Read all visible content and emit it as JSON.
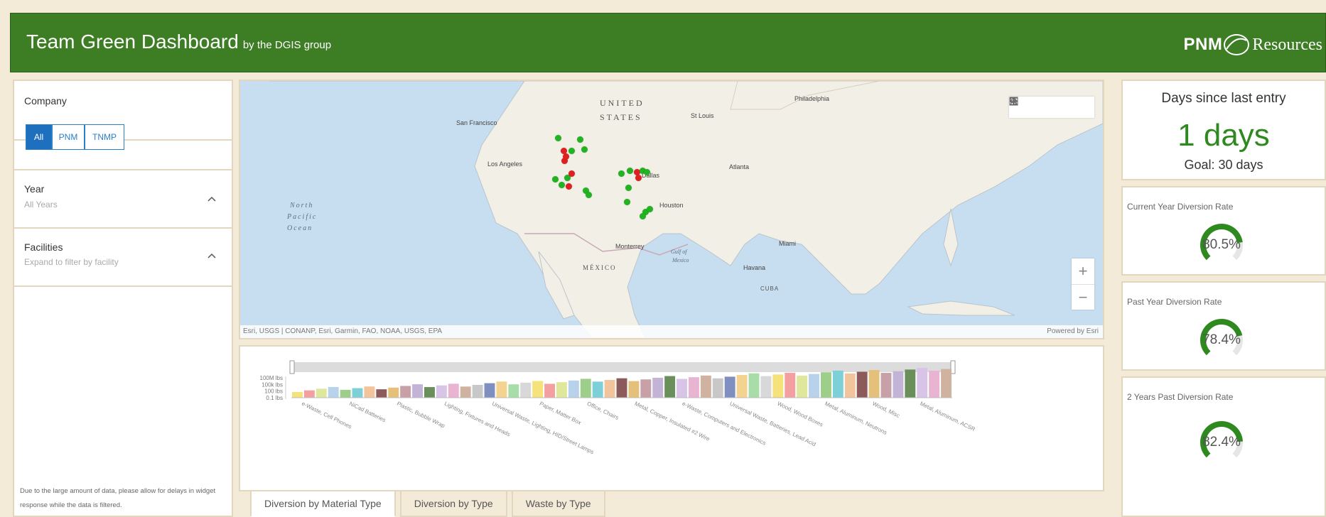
{
  "header": {
    "title": "Team Green Dashboard",
    "subtitle": "by the DGIS group",
    "logo_pnm": "PNM",
    "logo_resources": "Resources"
  },
  "filters": {
    "company_label": "Company",
    "company_options": [
      "All",
      "PNM",
      "TNMP"
    ],
    "company_selected": "All",
    "year_label": "Year",
    "year_value": "All Years",
    "facilities_label": "Facilities",
    "facilities_hint": "Expand to filter by facility",
    "note": "Due to the large amount of data, please allow for delays in widget response while the data is filtered."
  },
  "map": {
    "labels": {
      "united": "UNITED",
      "states": "STATES",
      "philadelphia": "Philadelphia",
      "san_francisco": "San Francisco",
      "st_louis": "St Louis",
      "los_angeles": "Los Angeles",
      "dallas": "Dallas",
      "atlanta": "Atlanta",
      "north": "North",
      "pacific": "Pacific",
      "ocean": "Ocean",
      "houston": "Houston",
      "monterrey": "Monterrey",
      "gulf_of": "Gulf of",
      "mexico_gulf": "Mexico",
      "miami": "Miami",
      "mexico": "MÉXICO",
      "havana": "Havana",
      "cuba": "CUBA"
    },
    "attribution": "Esri, USGS | CONANP, Esri, Garmin, FAO, NOAA, USGS, EPA",
    "powered_by": "Powered by Esri",
    "tools": [
      "search-icon",
      "home-icon",
      "legend-icon",
      "basemap-icon"
    ],
    "zoom_in": "+",
    "zoom_out": "−",
    "colors": {
      "green_marker": "#22b322",
      "red_marker": "#e02020",
      "water": "#c7def0",
      "land": "#f2efe6"
    }
  },
  "chart_data": {
    "type": "bar",
    "title": "",
    "y_scale": "log",
    "y_ticks": [
      "100M lbs",
      "100k lbs",
      "100 lbs",
      "0.1 lbs"
    ],
    "x_tick_labels": [
      "e-Waste, Cell Phones",
      "NiCad Batteries",
      "Plastic, Bubble Wrap",
      "Lighting, Fixtures and Heads",
      "Universal Waste, Lighting, HID/Street Lamps",
      "Paper, Matter Box",
      "Office, Chairs",
      "Metal, Copper, Insulated #2 Wire",
      "e-Waste, Computers and Electronics",
      "Universal Waste, Batteries, Lead Acid",
      "Wood, Wood Boxes",
      "Metal, Aluminum, Neutrons",
      "Wood, Misc",
      "Metal, Aluminum, ACSR"
    ],
    "bar_count": 55,
    "bar_colors": [
      "#f5e27a",
      "#b7d2ea",
      "#f2c49b",
      "#c8a0a8",
      "#d7c4e6",
      "#c8c8c8",
      "#a8dca8",
      "#f5a0a0",
      "#9ecf8a",
      "#8c5a5a",
      "#c3b3d7",
      "#e9b3d2",
      "#7f8fbf",
      "#d8d8d8",
      "#dfe89a",
      "#7dd0d8",
      "#e5c07b",
      "#6a8f5a",
      "#cfb3a0",
      "#f4d28f"
    ]
  },
  "tabs": [
    "Diversion by Material Type",
    "Diversion by Type",
    "Waste by Type"
  ],
  "tab_selected": "Diversion by Material Type",
  "indicators": {
    "days_title": "Days since last entry",
    "days_value": "1 days",
    "days_goal": "Goal: 30 days",
    "current_title": "Current Year Diversion Rate",
    "current_value": "80.5%",
    "current_fraction": 0.805,
    "past_title": "Past Year Diversion Rate",
    "past_value": "78.4%",
    "past_fraction": 0.784,
    "two_title": "2 Years Past Diversion Rate",
    "two_value": "82.4%",
    "two_fraction": 0.824,
    "gauge_color": "#2e8a1f"
  }
}
